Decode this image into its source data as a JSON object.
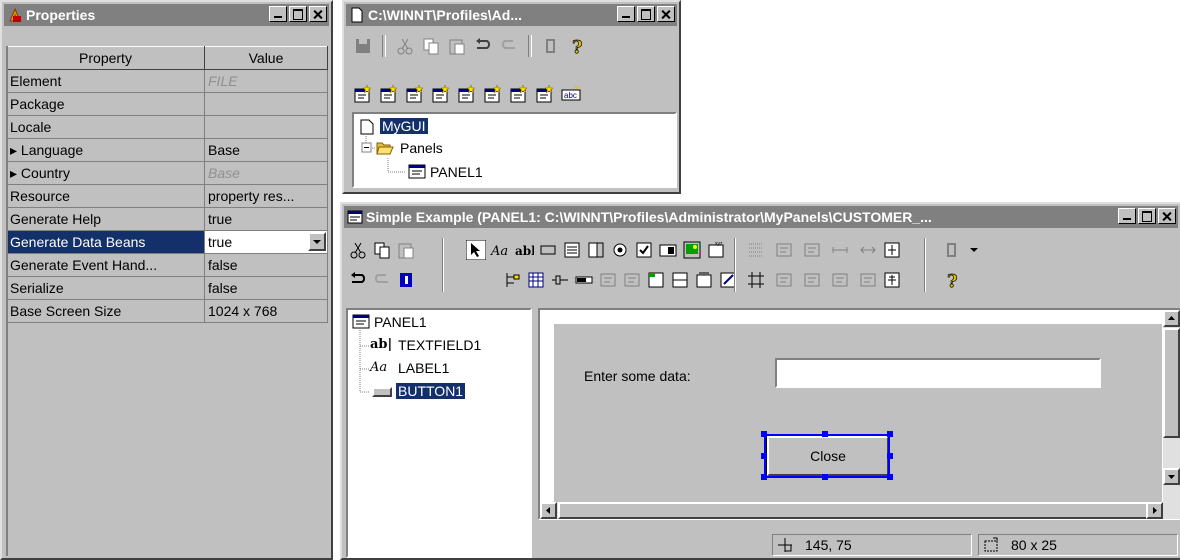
{
  "properties_window": {
    "title": "Properties",
    "headers": [
      "Property",
      "Value"
    ],
    "rows": [
      {
        "name": "Element",
        "value": "FILE",
        "dim": true
      },
      {
        "name": "Package",
        "value": ""
      },
      {
        "name": "Locale",
        "value": ""
      },
      {
        "name": "▸ Language",
        "value": "Base"
      },
      {
        "name": "▸ Country",
        "value": "Base",
        "dim": true
      },
      {
        "name": "Resource",
        "value": "property res..."
      },
      {
        "name": "Generate Help",
        "value": "true"
      },
      {
        "name": "Generate Data Beans",
        "value": "true",
        "selected": true
      },
      {
        "name": "Generate Event Hand...",
        "value": "false"
      },
      {
        "name": "Serialize",
        "value": "false"
      },
      {
        "name": "Base Screen Size",
        "value": "1024 x 768"
      }
    ]
  },
  "project_window": {
    "title": "C:\\WINNT\\Profiles\\Ad...",
    "tree": {
      "root": "MyGUI",
      "folder": "Panels",
      "panel": "PANEL1"
    }
  },
  "editor_window": {
    "title": "Simple Example (PANEL1: C:\\WINNT\\Profiles\\Administrator\\MyPanels\\CUSTOMER_...",
    "tree": {
      "root": "PANEL1",
      "children": [
        {
          "icon": "abl",
          "label": "TEXTFIELD1"
        },
        {
          "icon": "Aa",
          "label": "LABEL1"
        },
        {
          "icon": "button",
          "label": "BUTTON1",
          "selected": true
        }
      ]
    },
    "canvas": {
      "label_text": "Enter some data:",
      "textfield_value": "",
      "button_label": "Close"
    },
    "status": {
      "position": "145, 75",
      "size": "80 x 25"
    }
  },
  "colors": {
    "selection": "#14306a",
    "title_inactive": "#808080",
    "handles": "#0000ff"
  }
}
